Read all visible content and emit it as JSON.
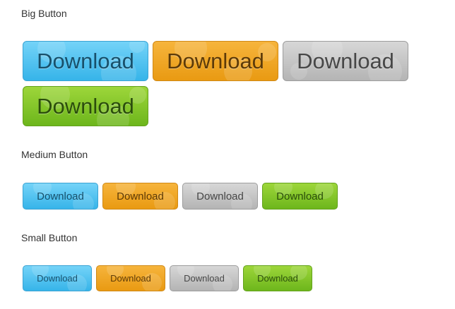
{
  "sections": {
    "big_title": "Big Button",
    "medium_title": "Medium Button",
    "small_title": "Small Button"
  },
  "big_buttons": [
    {
      "label": "Download",
      "color": "blue"
    },
    {
      "label": "Download",
      "color": "orange"
    },
    {
      "label": "Download",
      "color": "gray"
    },
    {
      "label": "Download",
      "color": "green"
    }
  ],
  "medium_buttons": [
    {
      "label": "Download",
      "color": "blue"
    },
    {
      "label": "Download",
      "color": "orange"
    },
    {
      "label": "Download",
      "color": "gray"
    },
    {
      "label": "Download",
      "color": "green"
    }
  ],
  "small_buttons": [
    {
      "label": "Download",
      "color": "blue"
    },
    {
      "label": "Download",
      "color": "orange"
    },
    {
      "label": "Download",
      "color": "gray"
    },
    {
      "label": "Download",
      "color": "green"
    }
  ],
  "colors": {
    "blue": "#36b4e9",
    "orange": "#e99a12",
    "gray": "#b4b4b4",
    "green": "#6db61c"
  }
}
